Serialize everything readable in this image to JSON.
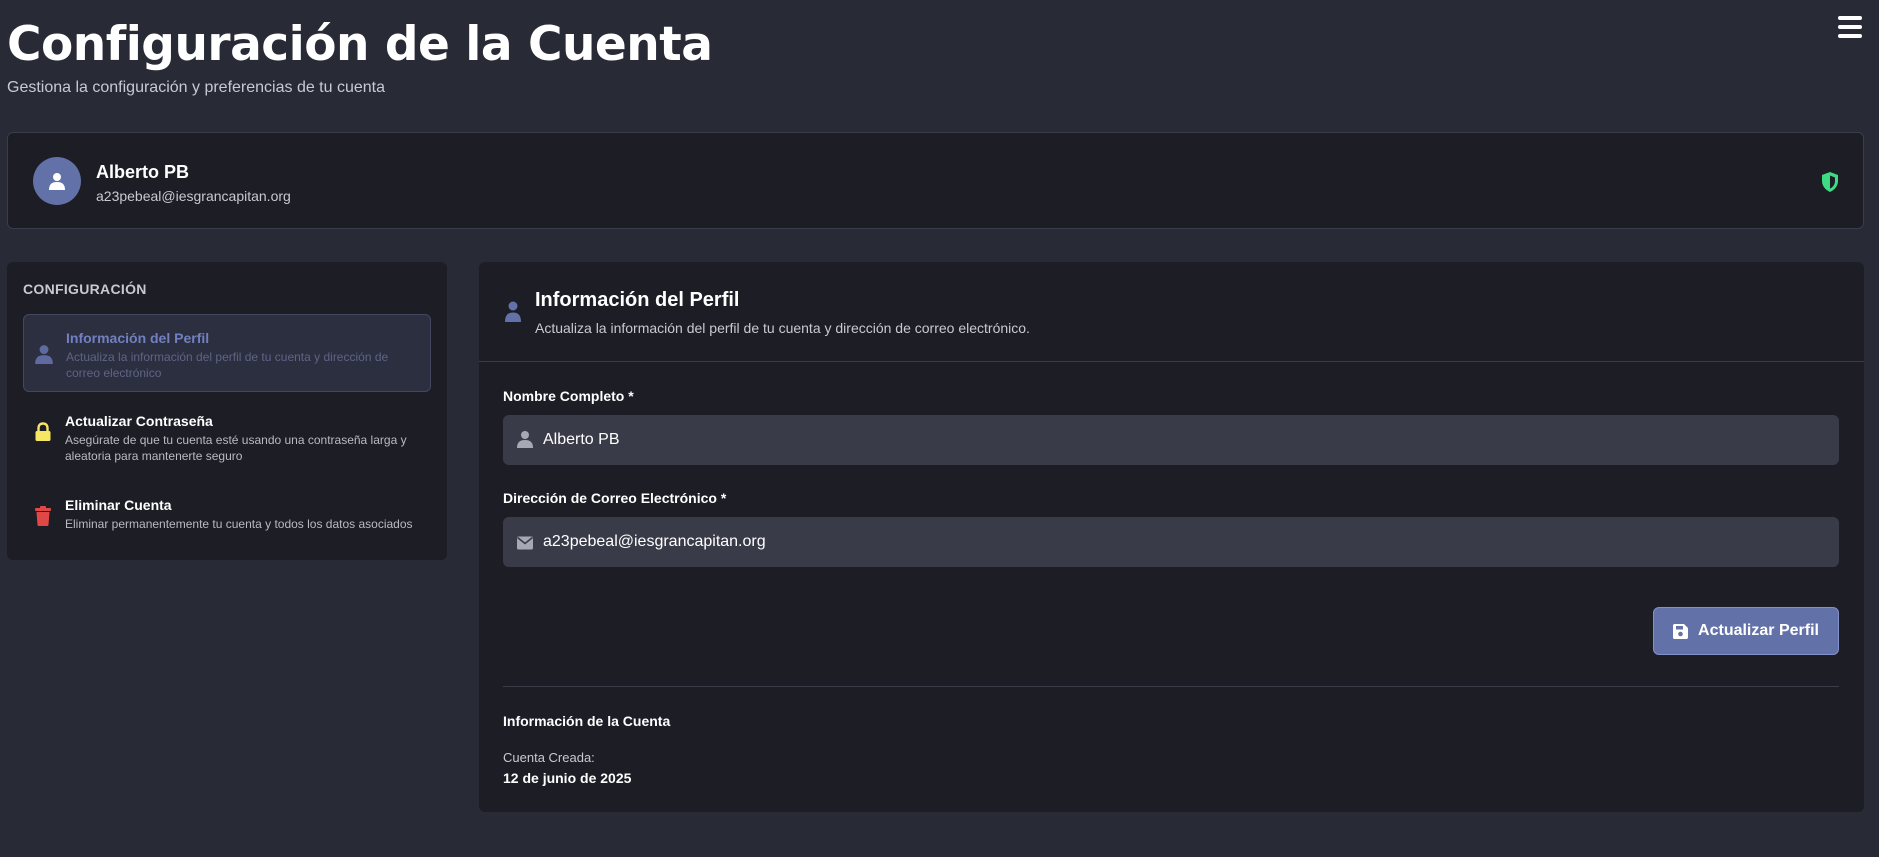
{
  "header": {
    "title": "Configuración de la Cuenta",
    "subtitle": "Gestiona la configuración y preferencias de tu cuenta"
  },
  "user": {
    "name": "Alberto PB",
    "email": "a23pebeal@iesgrancapitan.org"
  },
  "sidebar": {
    "heading": "CONFIGURACIÓN",
    "items": [
      {
        "title": "Información del Perfil",
        "description": "Actualiza la información del perfil de tu cuenta y dirección de correo electrónico",
        "icon": "user-icon",
        "active": true
      },
      {
        "title": "Actualizar Contraseña",
        "description": "Asegúrate de que tu cuenta esté usando una contraseña larga y aleatoria para mantenerte seguro",
        "icon": "lock-icon",
        "active": false
      },
      {
        "title": "Eliminar Cuenta",
        "description": "Eliminar permanentemente tu cuenta y todos los datos asociados",
        "icon": "trash-icon",
        "active": false
      }
    ]
  },
  "panel": {
    "title": "Información del Perfil",
    "description": "Actualiza la información del perfil de tu cuenta y dirección de correo electrónico.",
    "name_label": "Nombre Completo *",
    "name_value": "Alberto PB",
    "email_label": "Dirección de Correo Electrónico *",
    "email_value": "a23pebeal@iesgrancapitan.org",
    "save_label": "Actualizar Perfil",
    "account_info_title": "Información de la Cuenta",
    "created_label": "Cuenta Creada:",
    "created_value": "12 de junio de 2025"
  },
  "colors": {
    "background": "#282a36",
    "card": "#1c1d25",
    "accent": "#6271a8",
    "shield": "#3ddc84",
    "lock": "#f5e663",
    "trash": "#e04848"
  }
}
